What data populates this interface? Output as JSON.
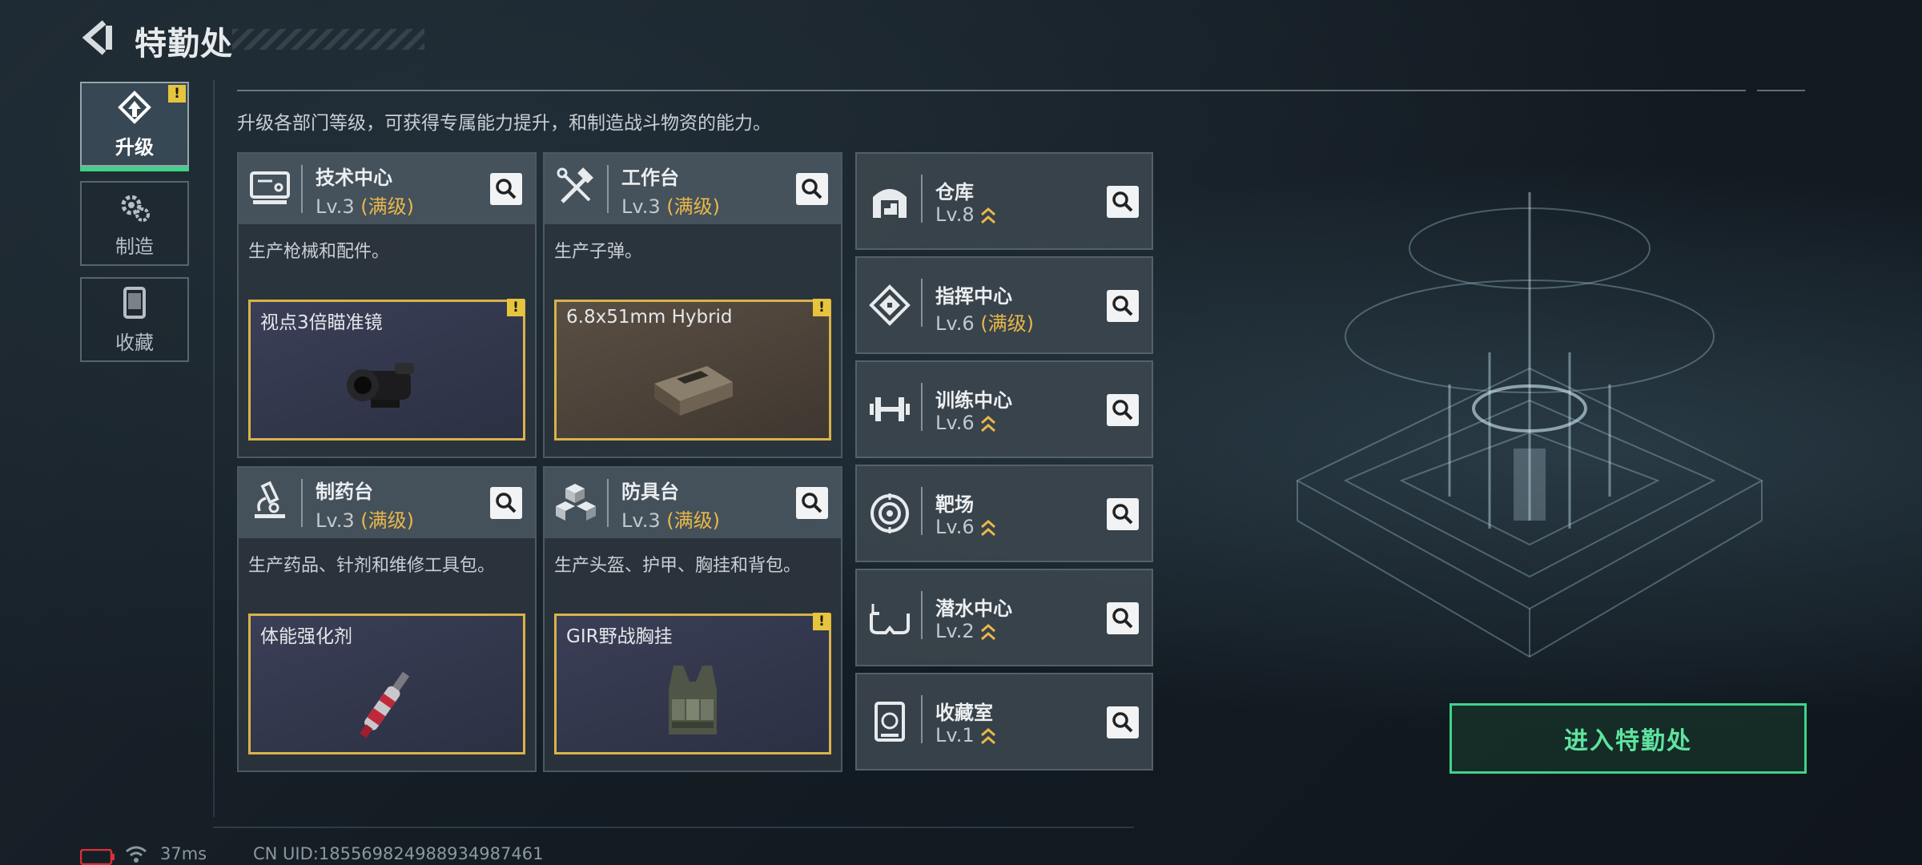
{
  "header": {
    "title": "特勤处"
  },
  "nav": {
    "items": [
      {
        "label": "升级",
        "active": true,
        "alert": "!"
      },
      {
        "label": "制造",
        "active": false
      },
      {
        "label": "收藏",
        "active": false
      }
    ]
  },
  "description": "升级各部门等级，可获得专属能力提升，和制造战斗物资的能力。",
  "departments": [
    {
      "name": "技术中心",
      "level": "Lv.3",
      "max": "(满级)",
      "desc": "生产枪械和配件。",
      "item": {
        "name": "视点3倍瞄准镜",
        "alert": "!"
      },
      "icon": "computer-icon"
    },
    {
      "name": "工作台",
      "level": "Lv.3",
      "max": "(满级)",
      "desc": "生产子弹。",
      "item": {
        "name": "6.8x51mm Hybrid",
        "alert": "!"
      },
      "icon": "hammer-wrench-icon"
    },
    {
      "name": "制药台",
      "level": "Lv.3",
      "max": "(满级)",
      "desc": "生产药品、针剂和维修工具包。",
      "item": {
        "name": "体能强化剂"
      },
      "icon": "microscope-icon"
    },
    {
      "name": "防具台",
      "level": "Lv.3",
      "max": "(满级)",
      "desc": "生产头盔、护甲、胸挂和背包。",
      "item": {
        "name": "GIR野战胸挂",
        "alert": "!"
      },
      "icon": "armor-blocks-icon"
    }
  ],
  "facilities": [
    {
      "name": "仓库",
      "level": "Lv.8",
      "max": "",
      "icon": "warehouse-icon"
    },
    {
      "name": "指挥中心",
      "level": "Lv.6",
      "max": "(满级)",
      "icon": "command-icon"
    },
    {
      "name": "训练中心",
      "level": "Lv.6",
      "max": "",
      "icon": "dumbbell-icon"
    },
    {
      "name": "靶场",
      "level": "Lv.6",
      "max": "",
      "icon": "target-icon"
    },
    {
      "name": "潜水中心",
      "level": "Lv.2",
      "max": "",
      "icon": "dive-mask-icon"
    },
    {
      "name": "收藏室",
      "level": "Lv.1",
      "max": "",
      "icon": "collection-icon"
    }
  ],
  "enter_button": "进入特勤处",
  "footer": {
    "ping": "37ms",
    "uid": "CN UID:185569824988934987461"
  },
  "colors": {
    "accent_green": "#3fd38a",
    "max_level": "#e8b84a",
    "alert": "#e7c43d"
  }
}
